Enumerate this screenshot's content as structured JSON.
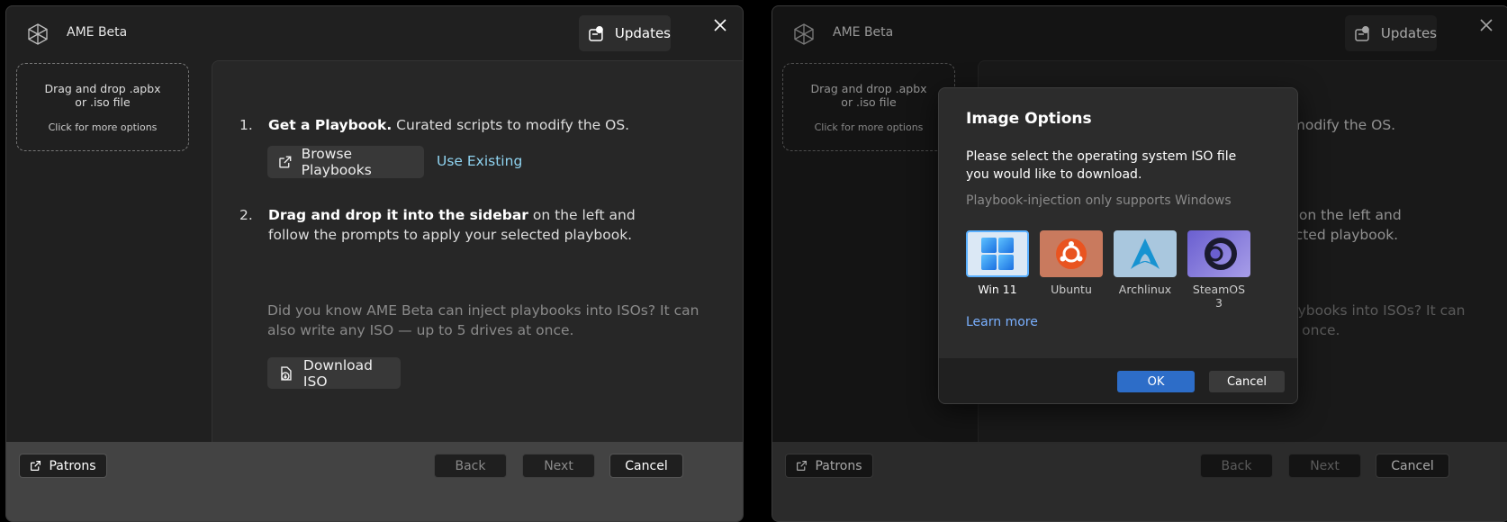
{
  "app": {
    "title": "AME Beta",
    "updates_label": "Updates"
  },
  "sidebar": {
    "drop_line1": "Drag and drop .apbx",
    "drop_line2": "or .iso file",
    "drop_hint": "Click for more options"
  },
  "steps": [
    {
      "num": "1.",
      "bold": "Get a Playbook.",
      "rest": " Curated scripts to modify the OS."
    },
    {
      "num": "2.",
      "bold": "Drag and drop it into the sidebar",
      "rest": " on the left and follow the prompts to apply your selected playbook."
    }
  ],
  "actions": {
    "browse_label": "Browse Playbooks",
    "use_existing_label": "Use Existing",
    "download_label": "Download ISO"
  },
  "info_text": "Did you know AME Beta can inject playbooks into ISOs? It can also write any ISO — up to 5 drives at once.",
  "footer": {
    "patrons_label": "Patrons",
    "back_label": "Back",
    "next_label": "Next",
    "cancel_label": "Cancel"
  },
  "dialog": {
    "title": "Image Options",
    "description": "Please select the operating system ISO file you would like to download.",
    "note": "Playbook-injection only supports Windows",
    "options": [
      {
        "name": "Win 11",
        "icon": "windows-icon",
        "selected": true
      },
      {
        "name": "Ubuntu",
        "icon": "ubuntu-icon",
        "selected": false
      },
      {
        "name": "Archlinux",
        "icon": "archlinux-icon",
        "selected": false
      },
      {
        "name": "SteamOS 3",
        "icon": "steamos-icon",
        "selected": false
      }
    ],
    "learn_more": "Learn more",
    "ok_label": "OK",
    "cancel_label": "Cancel"
  },
  "colors": {
    "accent": "#2d6dc8",
    "link": "#8fd3f0",
    "dialog_link": "#7ab0ff",
    "selection": "#5ab0ff"
  }
}
